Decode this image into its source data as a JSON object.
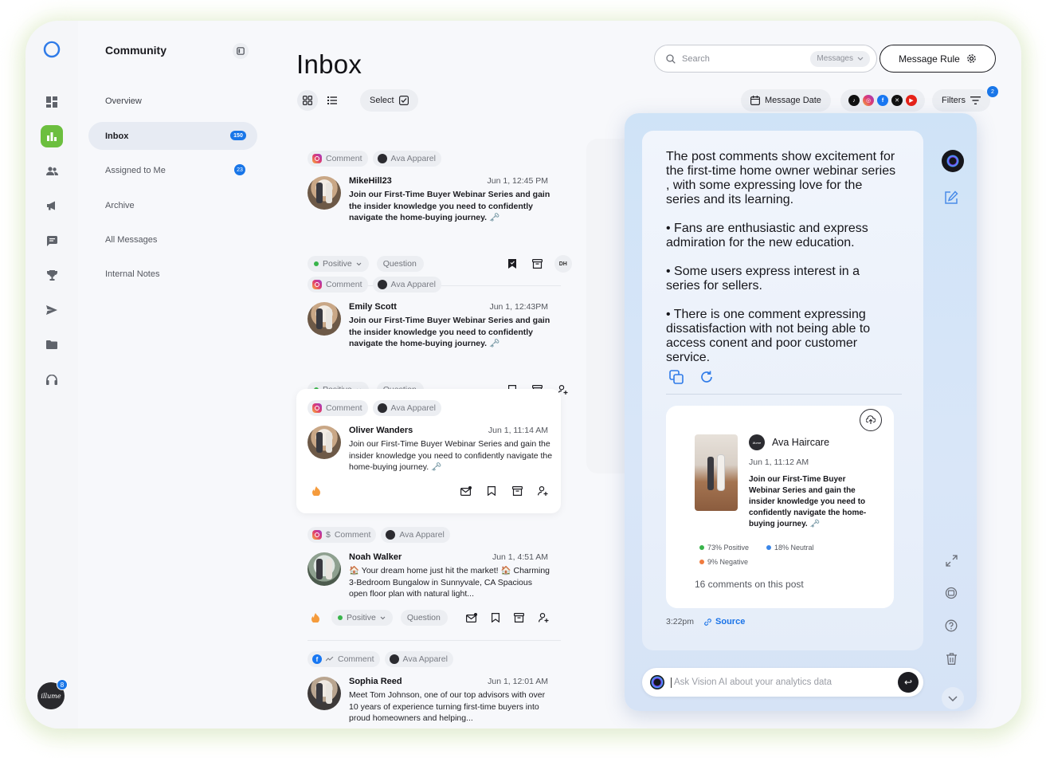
{
  "sidebar": {
    "title": "Community",
    "items": [
      {
        "label": "Overview"
      },
      {
        "label": "Inbox",
        "badge": "150"
      },
      {
        "label": "Assigned to Me",
        "badge": "23"
      },
      {
        "label": "Archive"
      },
      {
        "label": "All Messages"
      },
      {
        "label": "Internal Notes"
      }
    ]
  },
  "rail": {
    "icons": [
      "dashboard-icon",
      "analytics-icon",
      "users-icon",
      "megaphone-icon",
      "chat-icon",
      "trophy-icon",
      "send-icon",
      "folder-icon",
      "headset-icon"
    ],
    "avatar_text": "illume",
    "avatar_badge": "8"
  },
  "header": {
    "title": "Inbox",
    "search_placeholder": "Search",
    "search_scope": "Messages",
    "message_rule": "Message Rule",
    "select_label": "Select",
    "message_date": "Message Date",
    "filters": "Filters",
    "filters_badge": "2"
  },
  "messages": [
    {
      "type": "Comment",
      "brand": "Ava Apparel",
      "author": "MikeHill23",
      "date": "Jun 1,   12:45 PM",
      "text": "Join our First-Time Buyer Webinar Series and gain the insider knowledge you need to confidently navigate the home-buying journey. 🗝️",
      "sentiment": "Positive",
      "category": "Question",
      "assignee": "DH"
    },
    {
      "type": "Comment",
      "brand": "Ava Apparel",
      "author": "Emily Scott",
      "date": "Jun 1,   12:43PM",
      "text": "Join our First-Time Buyer Webinar Series and gain the insider knowledge you need to confidently navigate the home-buying journey. 🗝️",
      "sentiment": "Positive",
      "category": "Question"
    },
    {
      "type": "Comment",
      "brand": "Ava Apparel",
      "author": "Oliver Wanders",
      "date": "Jun 1,   11:14 AM",
      "text": "Join our First-Time Buyer Webinar Series and gain the insider knowledge you need to confidently navigate the home-buying journey. 🗝️"
    },
    {
      "type": "Comment",
      "brand": "Ava Apparel",
      "currency": "$",
      "author": "Noah Walker",
      "date": "Jun 1,   4:51 AM",
      "text": "🏠 Your dream home just hit the market! 🏠 Charming 3-Bedroom Bungalow in Sunnyvale, CA Spacious open floor plan with natural light...",
      "sentiment": "Positive",
      "category": "Question"
    },
    {
      "type": "Comment",
      "brand": "Ava Apparel",
      "author": "Sophia Reed",
      "date": "Jun 1,   12:01 AM",
      "text": "Meet Tom Johnson, one of our top advisors with over 10 years of experience turning first-time buyers into proud homeowners and helping..."
    }
  ],
  "ai": {
    "summary": [
      "The post comments show excitement for the first-time home owner webinar series , with some expressing love for the series and its learning.",
      "• Fans are enthusiastic and express admiration for the new education.",
      "• Some users express interest in a series for sellers.",
      "• There is one comment expressing dissatisfaction with not being able to access conent and poor customer service."
    ],
    "post": {
      "logo_text": "illume",
      "brand": "Ava Haircare",
      "date": "Jun 1, 11:12 AM",
      "text": "Join our First-Time Buyer Webinar Series and gain the insider knowledge you need to confidently navigate the home-buying journey. 🗝️",
      "positive": "73% Positive",
      "neutral": "18% Neutral",
      "negative": "9% Negative",
      "comments": "16 comments on this post"
    },
    "time": "3:22pm",
    "source": "Source",
    "ask_placeholder": "Ask Vision AI about your analytics data"
  },
  "colors": {
    "accent_green": "#6cbf3f",
    "badge_blue": "#1976e8",
    "positive": "#38b44a",
    "neutral": "#3a86e8",
    "negative": "#f07b3f"
  }
}
